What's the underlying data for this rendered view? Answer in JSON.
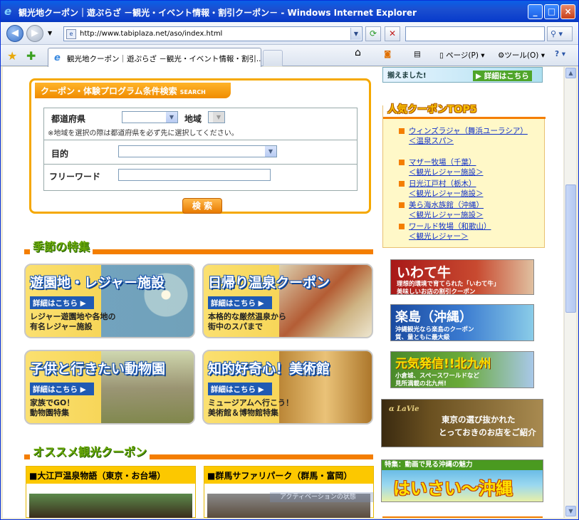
{
  "window": {
    "title": "観光地クーポン｜遊ぷらざ －観光・イベント情報・割引クーポン－ - Windows Internet Explorer",
    "url": "http://www.tabiplaza.net/aso/index.html",
    "tab_title": "観光地クーポン｜遊ぷらざ －観光・イベント情報・割引...",
    "page_menu": "ページ(P)",
    "tools_menu": "ツール(O)"
  },
  "search_panel": {
    "header": "クーポン・体験プログラム条件検索",
    "header_en": "SEARCH",
    "prefecture_label": "都道府県",
    "area_label": "地域",
    "area_note": "※地域を選択の際は都道府県を必ず先に選択してください。",
    "purpose_label": "目的",
    "freeword_label": "フリーワード",
    "search_button": "検 索"
  },
  "top_banner": {
    "text": "揃えました!",
    "link": "▶ 詳細はこちら"
  },
  "season": {
    "heading": "季節の特集",
    "cards": [
      {
        "title": "遊園地・レジャー施設",
        "more": "詳細はこちら ▶",
        "desc1": "レジャー遊園地や各地の",
        "desc2": "有名レジャー施設"
      },
      {
        "title": "日帰り温泉クーポン",
        "more": "詳細はこちら ▶",
        "desc1": "本格的な厳然温泉から",
        "desc2": "街中のスパまで"
      },
      {
        "title": "子供と行きたい動物園",
        "more": "詳細はこちら ▶",
        "desc1": "家族でGO！",
        "desc2": "動物園特集"
      },
      {
        "title": "知的好奇心！美術館",
        "more": "詳細はこちら ▶",
        "desc1": "ミュージアムへ行こう！",
        "desc2": "美術館＆博物館特集"
      }
    ]
  },
  "recommend": {
    "heading": "オススメ観光クーポン",
    "items": [
      "■大江戸温泉物語（東京・お台場）",
      "■群馬サファリパーク（群馬・富岡）"
    ]
  },
  "top5": {
    "heading": "人気クーポンTOP5",
    "items": [
      {
        "name": "ウィンズラジャ（舞浜ユーラシア）",
        "name2": "",
        "cat": "＜温泉スパ＞"
      },
      {
        "name": "マザー牧場（千葉）",
        "cat": "＜観光レジャー施設＞"
      },
      {
        "name": "日光江戸村（栃木）",
        "cat": "＜観光レジャー施設＞"
      },
      {
        "name": "美ら海水族館（沖縄）",
        "cat": "＜観光レジャー施設＞"
      },
      {
        "name": "ワールド牧場（和歌山）",
        "cat": "＜観光レジャー＞"
      }
    ]
  },
  "banners": {
    "iwate": {
      "title": "いわて牛",
      "sub1": "理想的環境で育てられた「いわて牛」",
      "sub2": "美味しいお店の割引クーポン"
    },
    "okinawa": {
      "title": "楽島（沖縄）",
      "sub1": "沖縄観光なら楽島のクーポン",
      "sub2": "質、量ともに最大級"
    },
    "kyushu": {
      "title": "元気発信!!北九州",
      "sub1": "小倉城、スペースワールドなど",
      "sub2": "見所満載の北九州!"
    },
    "lavie": {
      "logo": "α LaVie",
      "line1": "東京の選び抜かれた",
      "line2": "とっておきのお店をご紹介"
    },
    "video": {
      "top": "特集：動画で見る沖縄の魅力",
      "main": "はいさい〜沖縄"
    }
  },
  "watermark": "アクティベーションの状態"
}
